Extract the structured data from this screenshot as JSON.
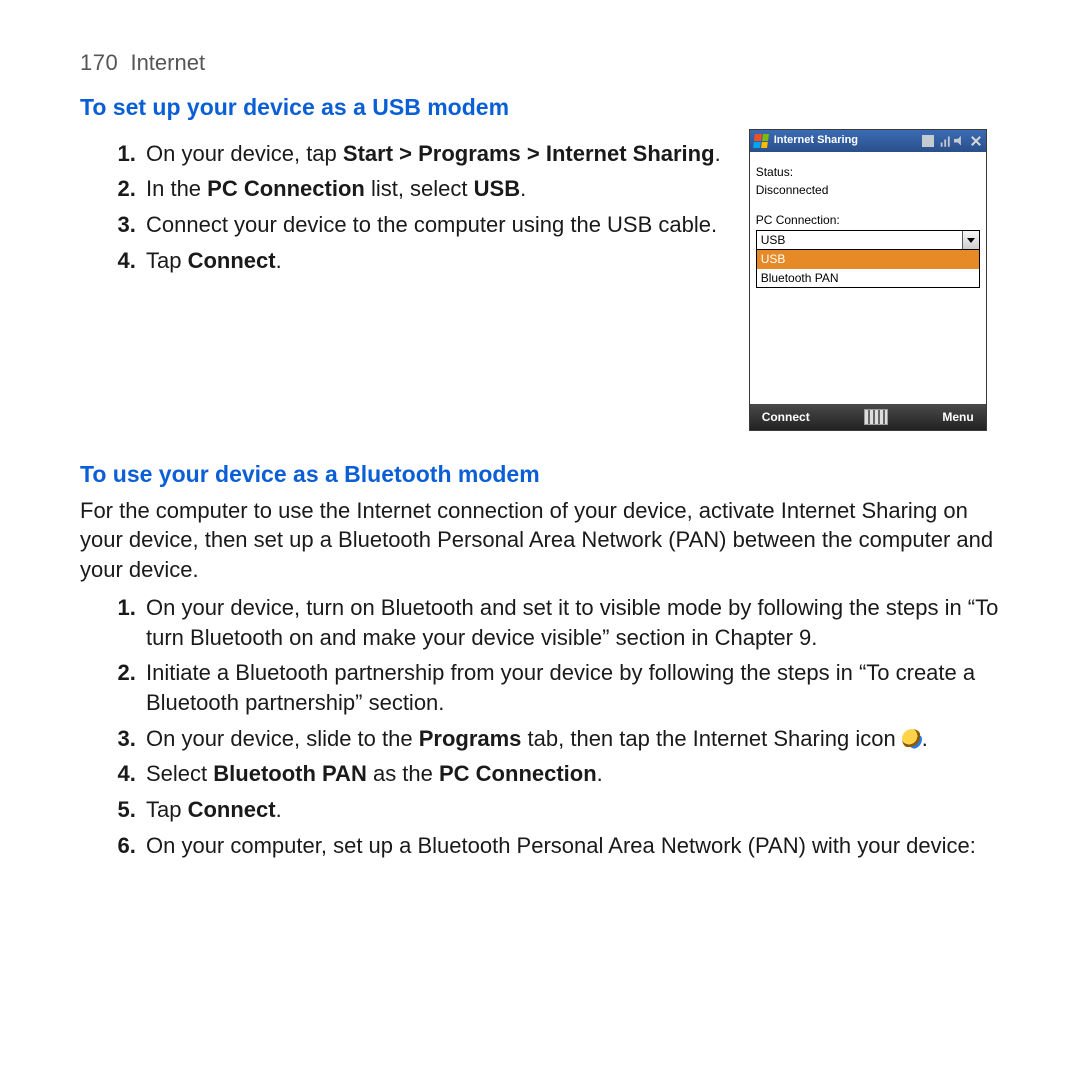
{
  "page": {
    "number": "170",
    "section": "Internet"
  },
  "usb_section": {
    "heading": "To set up your device as a USB modem",
    "steps": {
      "s1_a": "On your device, tap ",
      "s1_b": "Start > Programs > Internet Sharing",
      "s1_c": ".",
      "s2_a": "In the ",
      "s2_b": "PC Connection",
      "s2_c": " list, select ",
      "s2_d": "USB",
      "s2_e": ".",
      "s3": "Connect your device to the computer using the USB cable.",
      "s4_a": "Tap ",
      "s4_b": "Connect",
      "s4_c": "."
    }
  },
  "bt_section": {
    "heading": "To use your device as a Bluetooth modem",
    "intro": "For the computer to use the Internet connection of your device, activate Internet Sharing on your device, then set up a Bluetooth Personal Area Network (PAN) between the computer and your device.",
    "steps": {
      "s1": "On your device, turn on Bluetooth and set it to visible mode by following the steps in “To turn Bluetooth on and make your device visible” section in Chapter 9.",
      "s2": "Initiate a Bluetooth partnership from your device by following the steps in “To create a Bluetooth partnership” section.",
      "s3_a": "On your device, slide to the ",
      "s3_b": "Programs",
      "s3_c": " tab, then tap the Internet Sharing icon ",
      "s3_d": ".",
      "s4_a": "Select ",
      "s4_b": "Bluetooth PAN",
      "s4_c": " as the ",
      "s4_d": "PC Connection",
      "s4_e": ".",
      "s5_a": "Tap ",
      "s5_b": "Connect",
      "s5_c": ".",
      "s6": "On your computer, set up a Bluetooth Personal Area Network (PAN) with your device:"
    }
  },
  "phone": {
    "title": "Internet Sharing",
    "status_label": "Status:",
    "status_value": "Disconnected",
    "pc_conn_label": "PC Connection:",
    "selected": "USB",
    "options": {
      "o1": "USB",
      "o2": "Bluetooth PAN"
    },
    "soft_left": "Connect",
    "soft_right": "Menu"
  }
}
